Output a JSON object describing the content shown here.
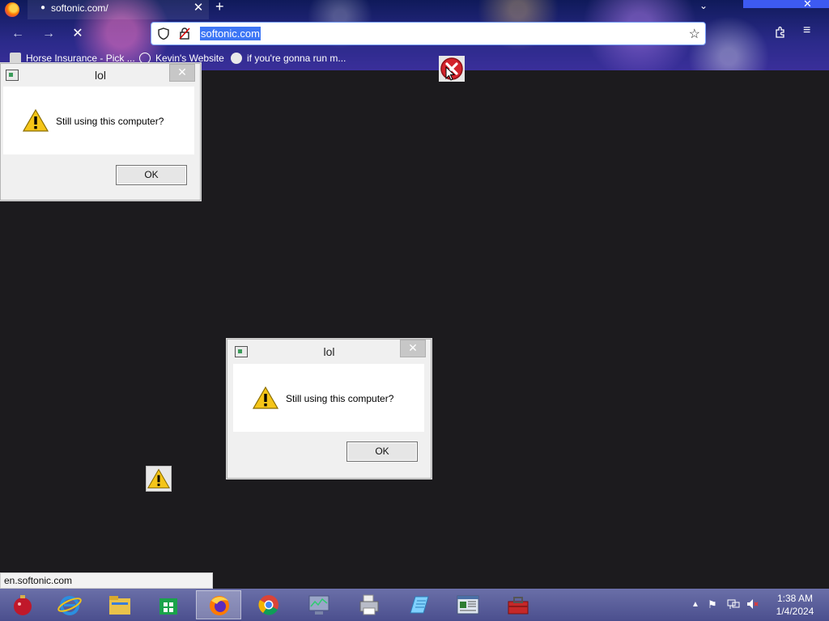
{
  "browser": {
    "tab": {
      "title": "softonic.com/",
      "close": "✕"
    },
    "new_tab": "+",
    "tabs_list": "⌄",
    "window_close": "✕",
    "nav": {
      "back": "←",
      "forward": "→",
      "stop": "✕"
    },
    "url": "softonic.com",
    "star": "☆",
    "menu": "≡",
    "bookmarks": [
      {
        "label": "Horse Insurance - Pick ..."
      },
      {
        "label": "Kevin's Website"
      },
      {
        "label": "if you're gonna run m..."
      }
    ]
  },
  "dialogs": [
    {
      "title": "lol",
      "message": "Still using this computer?",
      "ok": "OK",
      "close": "✕"
    },
    {
      "title": "lol",
      "message": "Still using this computer?",
      "ok": "OK",
      "close": "✕"
    }
  ],
  "status_text": "en.softonic.com",
  "taskbar": {
    "items": [
      {
        "name": "start-ornament-icon",
        "color": "#c0182a"
      },
      {
        "name": "internet-explorer-icon",
        "color": "#2b8fe0"
      },
      {
        "name": "file-explorer-icon",
        "color": "#e9c24a"
      },
      {
        "name": "store-icon",
        "color": "#1aa34a"
      },
      {
        "name": "firefox-icon",
        "color": "#ff7a00"
      },
      {
        "name": "chrome-icon",
        "color": "#db4437"
      },
      {
        "name": "task-manager-icon",
        "color": "#9aa6c8"
      },
      {
        "name": "printer-icon",
        "color": "#b8bcc8"
      },
      {
        "name": "notepad-icon",
        "color": "#7fd0ff"
      },
      {
        "name": "news-window-icon",
        "color": "#dfe6f0"
      },
      {
        "name": "toolbox-icon",
        "color": "#c62828"
      }
    ],
    "time": "1:38 AM",
    "date": "1/4/2024"
  }
}
